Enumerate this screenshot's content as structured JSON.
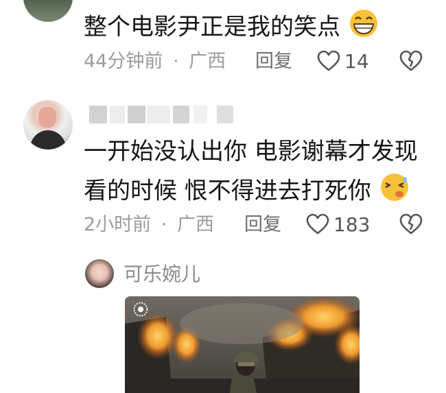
{
  "comment1": {
    "text": "整个电影尹正是我的笑点",
    "time": "44分钟前",
    "location": "广西",
    "reply_label": "回复",
    "likes": "14",
    "emoji_icon": "grinning-face-icon"
  },
  "comment2": {
    "line1": "一开始没认出你 电影谢幕才发现",
    "line2": "看的时候 恨不得进去打死你",
    "time": "2小时前",
    "location": "广西",
    "reply_label": "回复",
    "likes": "183",
    "emoji_icon": "confounded-face-icon"
  },
  "reply_preview": {
    "username": "可乐婉儿"
  },
  "common": {
    "separator": "·"
  },
  "colors": {
    "text": "#161616",
    "meta": "#9c9c9c",
    "accent_fire": "#f2a13a"
  }
}
